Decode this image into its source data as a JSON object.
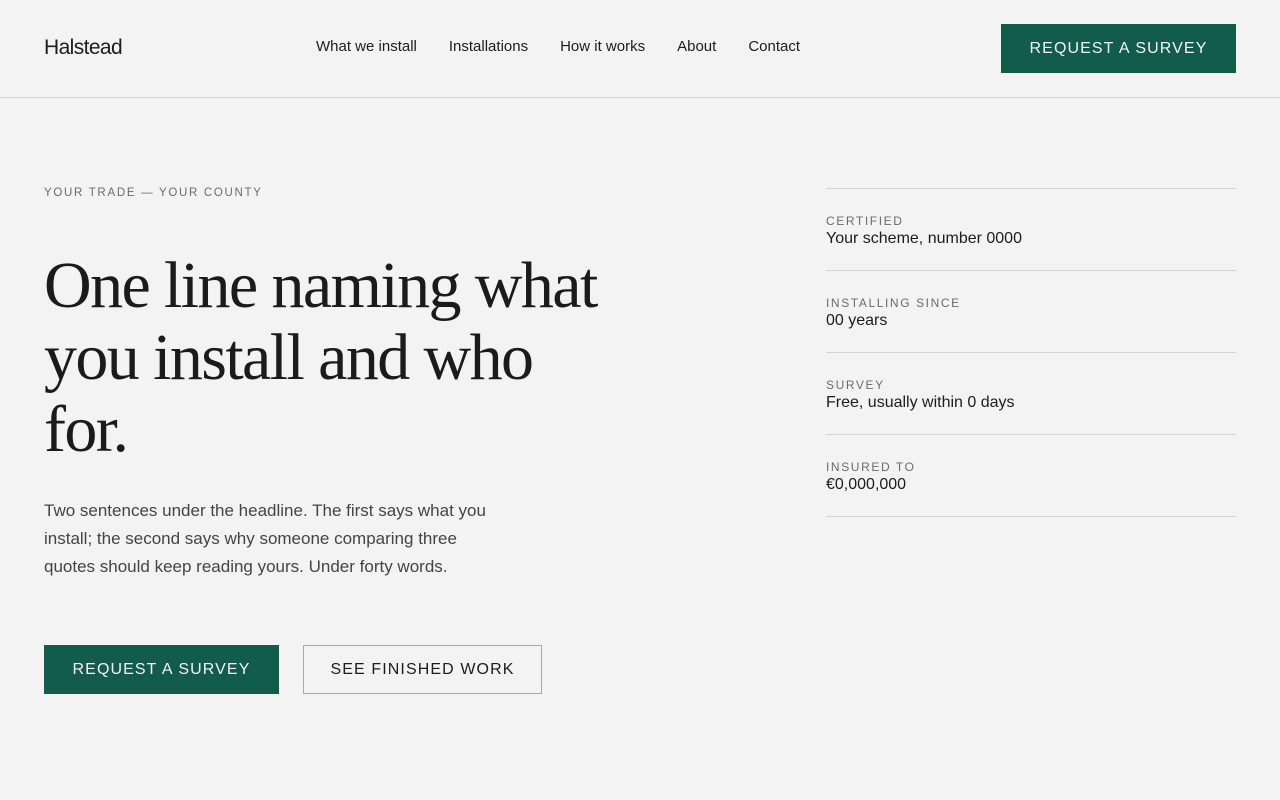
{
  "brand": {
    "name": "Halstead"
  },
  "nav": {
    "items": [
      {
        "label": "What we install"
      },
      {
        "label": "Installations"
      },
      {
        "label": "How it works"
      },
      {
        "label": "About"
      },
      {
        "label": "Contact"
      }
    ],
    "cta_label": "REQUEST A SURVEY"
  },
  "hero": {
    "eyebrow": "YOUR TRADE — YOUR COUNTY",
    "headline": "One line naming what you install and who for.",
    "lede": "Two sentences under the headline. The first says what you install; the second says why someone comparing three quotes should keep reading yours. Under forty words.",
    "primary_cta": "REQUEST A SURVEY",
    "secondary_cta": "SEE FINISHED WORK"
  },
  "facts": [
    {
      "label": "CERTIFIED",
      "value": "Your scheme, number 0000"
    },
    {
      "label": "INSTALLING SINCE",
      "value": "00 years"
    },
    {
      "label": "SURVEY",
      "value": "Free, usually within 0 days"
    },
    {
      "label": "INSURED TO",
      "value": "€0,000,000"
    }
  ],
  "colors": {
    "accent": "#115c4a",
    "background": "#f3f3f3",
    "text": "#1c1c1c",
    "muted": "#6b6b6b",
    "divider": "#d3d3d3"
  }
}
